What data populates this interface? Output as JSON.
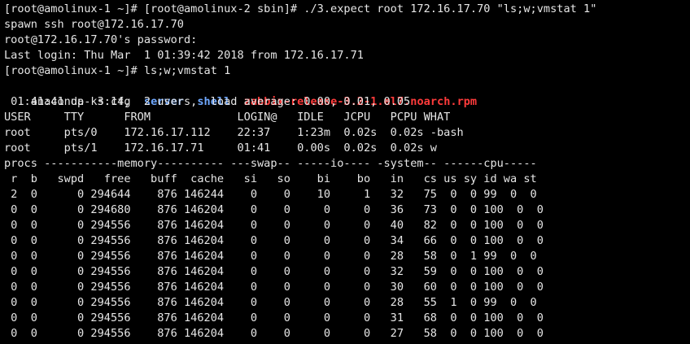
{
  "terminal": {
    "lines": [
      "[root@amolinux-1 ~]# [root@amolinux-2 sbin]# ./3.expect root 172.16.17.70 \"ls;w;vmstat 1\"",
      "spawn ssh root@172.16.17.70",
      "root@172.16.17.70's password:",
      "Last login: Thu Mar  1 01:39:42 2018 from 172.16.17.71",
      "[root@amolinux-1 ~]# ls;w;vmstat 1"
    ],
    "ls_output": {
      "file": "anaconda-ks.cfg",
      "dir1": "server",
      "dir2": "shell",
      "rpm": "zabbix-release-3.2-1.el7.noarch.rpm"
    },
    "w_output": [
      " 01:41:41 up  3:14,  2 users,  load average: 0.00, 0.01, 0.05",
      "USER     TTY      FROM             LOGIN@   IDLE   JCPU   PCPU WHAT",
      "root     pts/0    172.16.17.112    22:37    1:23m  0.02s  0.02s -bash",
      "root     pts/1    172.16.17.71     01:41    0.00s  0.02s  0.02s w"
    ],
    "vmstat_output": [
      "procs -----------memory---------- ---swap-- -----io---- -system-- ------cpu-----",
      " r  b   swpd   free   buff  cache   si   so    bi    bo   in   cs us sy id wa st",
      " 2  0      0 294644    876 146244    0    0    10     1   32   75  0  0 99  0  0",
      " 0  0      0 294680    876 146204    0    0     0     0   36   73  0  0 100  0  0",
      " 0  0      0 294556    876 146204    0    0     0     0   40   82  0  0 100  0  0",
      " 0  0      0 294556    876 146204    0    0     0     0   34   66  0  0 100  0  0",
      " 0  0      0 294556    876 146204    0    0     0     0   28   58  0  1 99  0  0",
      " 0  0      0 294556    876 146204    0    0     0     0   32   59  0  0 100  0  0",
      " 0  0      0 294556    876 146204    0    0     0     0   30   60  0  0 100  0  0",
      " 0  0      0 294556    876 146204    0    0     0     0   28   55  1  0 99  0  0",
      " 0  0      0 294556    876 146204    0    0     0     0   31   68  0  0 100  0  0",
      " 0  0      0 294556    876 146204    0    0     0     0   27   58  0  0 100  0  0"
    ]
  },
  "colors": {
    "background": "#000000",
    "foreground": "#e6e6e6",
    "directory": "#6fa8ff",
    "rpm_archive": "#ff3b3b"
  }
}
